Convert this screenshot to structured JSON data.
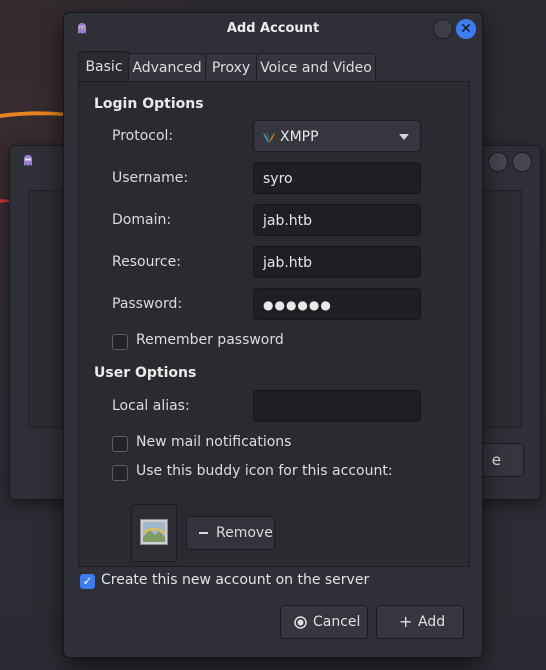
{
  "dialog": {
    "title": "Add Account",
    "close_glyph": "✕",
    "icons": {
      "app": "pidgin-icon",
      "protocol": "xmpp-icon",
      "cancel": "cancel-icon",
      "add": "plus-icon",
      "remove": "minus-icon",
      "buddy_icon": "image-icon"
    }
  },
  "tabs": [
    {
      "label": "Basic",
      "active": true
    },
    {
      "label": "Advanced",
      "active": false
    },
    {
      "label": "Proxy",
      "active": false
    },
    {
      "label": "Voice and Video",
      "active": false
    }
  ],
  "login_options": {
    "heading": "Login Options",
    "protocol": {
      "label": "Protocol:",
      "value": "XMPP"
    },
    "username": {
      "label": "Username:",
      "value": "syro"
    },
    "domain": {
      "label": "Domain:",
      "value": "jab.htb"
    },
    "resource": {
      "label": "Resource:",
      "value": "jab.htb"
    },
    "password": {
      "label": "Password:",
      "value": "●●●●●●"
    },
    "remember_password": {
      "label": "Remember password",
      "checked": false
    }
  },
  "user_options": {
    "heading": "User Options",
    "local_alias": {
      "label": "Local alias:",
      "value": ""
    },
    "new_mail": {
      "label": "New mail notifications",
      "checked": false
    },
    "buddy_icon": {
      "label": "Use this buddy icon for this account:",
      "checked": false
    },
    "remove_label": "Remove"
  },
  "create_on_server": {
    "label": "Create this new account on the server",
    "checked": true,
    "glyph": "✓"
  },
  "buttons": {
    "cancel_label": "Cancel",
    "add_label": "Add",
    "add_glyph": "+"
  },
  "background_window": {
    "button_fragment": "e"
  },
  "colors": {
    "accent": "#3d7cf0",
    "swoosh_orange": "#e8841f",
    "swoosh_red": "#c8323c"
  }
}
